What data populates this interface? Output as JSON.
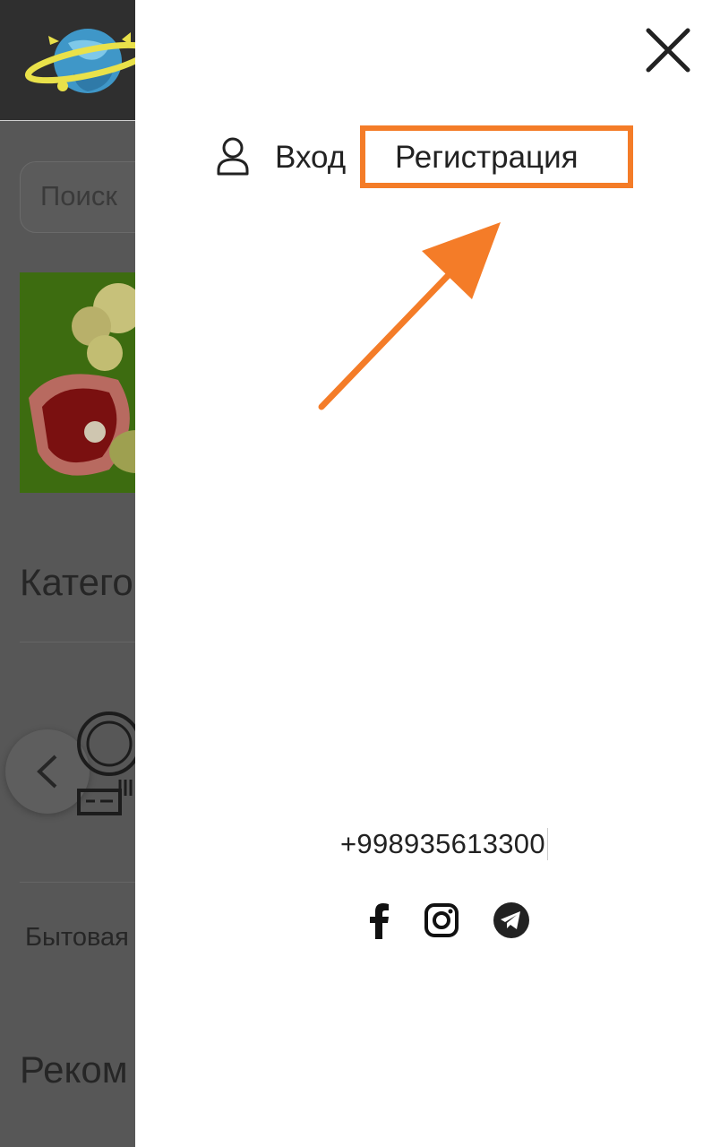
{
  "background": {
    "search_placeholder": "Поиск",
    "categories_heading": "Катего",
    "category_label": "Бытовая",
    "recommended_heading": "Реком"
  },
  "drawer": {
    "login_label": "Вход",
    "register_label": "Регистрация",
    "phone": "+998935613300",
    "social": [
      "facebook-icon",
      "instagram-icon",
      "telegram-icon"
    ]
  },
  "colors": {
    "annotation_orange": "#f47c28",
    "overlay": "#575757",
    "drawer_bg": "#ffffff"
  }
}
